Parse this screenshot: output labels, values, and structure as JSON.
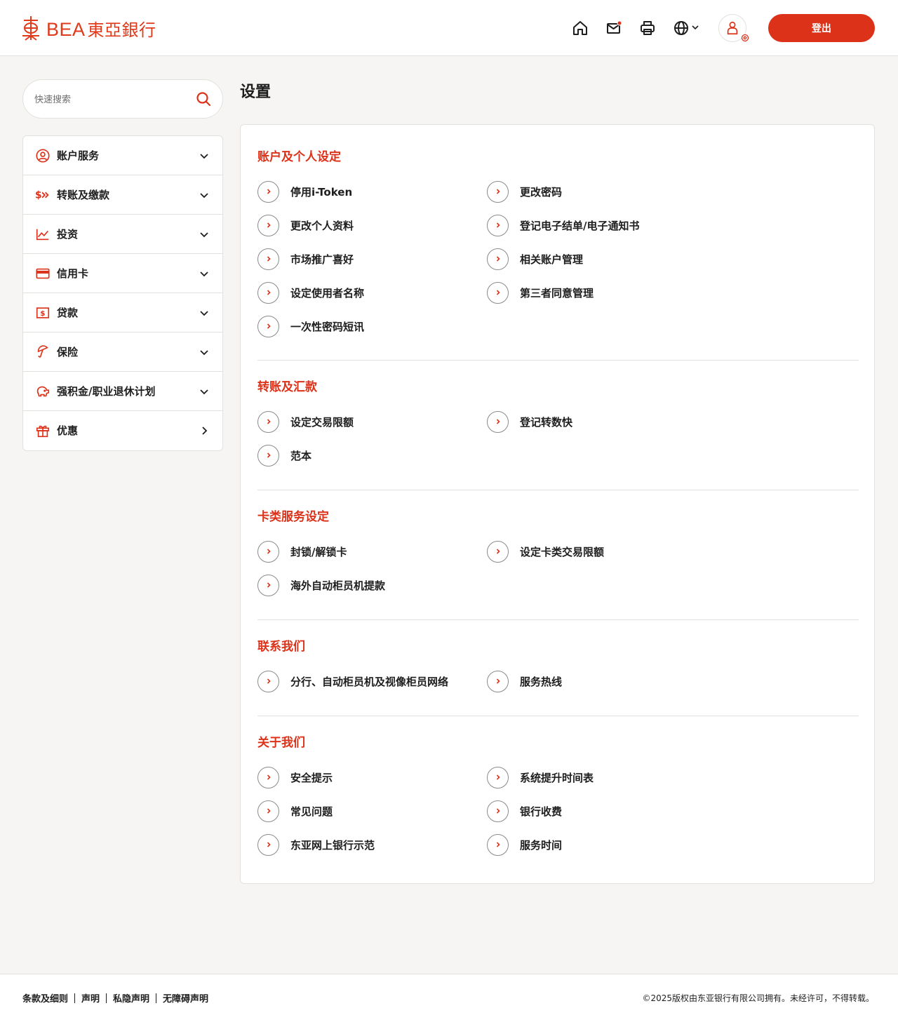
{
  "brand": {
    "name": "BEA",
    "name_cn": "東亞銀行",
    "accent_color": "#dc3219"
  },
  "header": {
    "icons": [
      "home-icon",
      "mail-icon",
      "print-icon",
      "globe-icon",
      "profile-icon"
    ],
    "mail_unread_dot": true,
    "logout_label": "登出"
  },
  "search": {
    "placeholder": "快速搜索"
  },
  "sidebar": {
    "items": [
      {
        "label": "账户服务",
        "icon": "account-icon",
        "chevron": "down"
      },
      {
        "label": "转账及缴款",
        "icon": "transfer-icon",
        "chevron": "down"
      },
      {
        "label": "投资",
        "icon": "investment-icon",
        "chevron": "down"
      },
      {
        "label": "信用卡",
        "icon": "credit-card-icon",
        "chevron": "down"
      },
      {
        "label": "贷款",
        "icon": "loan-icon",
        "chevron": "down"
      },
      {
        "label": "保险",
        "icon": "insurance-icon",
        "chevron": "down"
      },
      {
        "label": "强积金/职业退休计划",
        "icon": "piggy-bank-icon",
        "chevron": "down"
      },
      {
        "label": "优惠",
        "icon": "gift-icon",
        "chevron": "right"
      }
    ]
  },
  "page": {
    "title": "设置"
  },
  "sections": [
    {
      "title": "账户及个人设定",
      "links": [
        "停用i-Token",
        "更改密码",
        "更改个人资料",
        "登记电子结单/电子通知书",
        "市场推广喜好",
        "相关账户管理",
        "设定使用者名称",
        "第三者同意管理",
        "一次性密码短讯"
      ]
    },
    {
      "title": "转账及汇款",
      "links": [
        "设定交易限额",
        "登记转数快",
        "范本"
      ]
    },
    {
      "title": "卡类服务设定",
      "links": [
        "封锁/解锁卡",
        "设定卡类交易限额",
        "海外自动柜员机提款"
      ]
    },
    {
      "title": "联系我们",
      "links": [
        "分行、自动柜员机及视像柜员网络",
        "服务热线"
      ]
    },
    {
      "title": "关于我们",
      "links": [
        "安全提示",
        "系统提升时间表",
        "常见问题",
        "银行收费",
        "东亚网上银行示范",
        "服务时间"
      ]
    }
  ],
  "footer": {
    "links": [
      "条款及细则",
      "声明",
      "私隐声明",
      "无障碍声明"
    ],
    "copyright": "©2025版权由东亚银行有限公司拥有。未经许可，不得转载。"
  }
}
